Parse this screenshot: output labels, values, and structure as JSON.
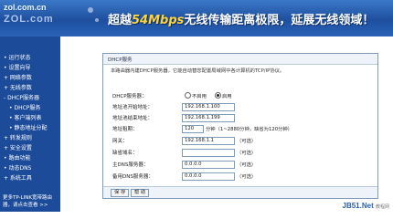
{
  "banner": {
    "site": "zol.com.cn",
    "brand": "ZOL.com",
    "slogan_prefix": "超越",
    "slogan_speed": "54Mbps",
    "slogan_rest": "无线传输距离极限，延展无线领域！"
  },
  "sidebar": {
    "items": [
      {
        "label": "• 运行状态"
      },
      {
        "label": "• 设置向导"
      },
      {
        "label": "+ 网络参数"
      },
      {
        "label": "+ 无线参数"
      },
      {
        "label": "- DHCP服务器"
      },
      {
        "label": "• DHCP服务",
        "sub": true
      },
      {
        "label": "• 客户端列表",
        "sub": true
      },
      {
        "label": "• 静态地址分配",
        "sub": true
      },
      {
        "label": "+ 转发规则"
      },
      {
        "label": "+ 安全设置"
      },
      {
        "label": "• 路由功能"
      },
      {
        "label": "• 动态DNS"
      },
      {
        "label": "+ 系统工具"
      }
    ],
    "footer1": "更多TP-LINK宽带路由",
    "footer2": "器，请点击查看 >>"
  },
  "panel": {
    "title": "DHCP服务",
    "description": "本路由器内建DHCP服务器，它能自动替您配置局域网中各计算机的TCP/IP协议。",
    "dhcp_label": "DHCP服务器：",
    "opt_disable": "不启用",
    "opt_enable": "启用",
    "start_label": "地址池开始地址：",
    "start_value": "192.168.1.100",
    "end_label": "地址池结束地址：",
    "end_value": "192.168.1.199",
    "lease_label": "地址租期：",
    "lease_value": "120",
    "lease_note": "分钟（1~2880分钟，缺省为120分钟）",
    "gw_label": "网关：",
    "gw_value": "192.168.1.1",
    "optional": "（可选）",
    "domain_label": "缺省域名：",
    "domain_value": "",
    "dns1_label": "主DNS服务器：",
    "dns1_value": "0.0.0.0",
    "dns2_label": "备用DNS服务器：",
    "dns2_value": "0.0.0.0",
    "save": "保 存",
    "help": "帮 助"
  },
  "watermark": {
    "text": "JB51.Net",
    "sub": "教程网"
  }
}
